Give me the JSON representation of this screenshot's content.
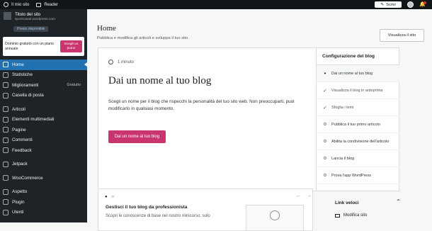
{
  "topbar": {
    "my_site": "Il mio sito",
    "reader": "Reader",
    "write": "Scrivi"
  },
  "site": {
    "title": "Titolo del sito",
    "url": "sportcasati.wordpress.com",
    "plan": "Presto disponibile"
  },
  "promo": {
    "text": "Dominio gratuito con un piano annuale",
    "button": "Scegli un piano"
  },
  "nav": [
    {
      "label": "Home",
      "extra": ""
    },
    {
      "label": "Statistiche",
      "extra": ""
    },
    {
      "label": "Miglioramenti",
      "extra": "Gratuito"
    },
    {
      "label": "Casella di posta",
      "extra": ""
    },
    {
      "label": "Articoli",
      "extra": ""
    },
    {
      "label": "Elementi multimediali",
      "extra": ""
    },
    {
      "label": "Pagine",
      "extra": ""
    },
    {
      "label": "Commenti",
      "extra": ""
    },
    {
      "label": "Feedback",
      "extra": ""
    },
    {
      "label": "Jetpack",
      "extra": ""
    },
    {
      "label": "WooCommerce",
      "extra": ""
    },
    {
      "label": "Aspetto",
      "extra": ""
    },
    {
      "label": "Plugin",
      "extra": ""
    },
    {
      "label": "Utenti",
      "extra": ""
    }
  ],
  "header": {
    "title": "Home",
    "subtitle": "Pubblica e modifica gli articoli e sviluppa il tuo sito.",
    "view_site": "Visualizza il sito"
  },
  "setup": {
    "time": "1 minuto",
    "heading": "Dai un nome al tuo blog",
    "paragraph": "Scegli un nome per il blog che rispecchi la personalità del tuo sito web. Non preoccuparti, puoi modificarlo in qualsiasi momento.",
    "button": "Dai un nome al tuo blog"
  },
  "checklist": {
    "title": "Configurazione del blog",
    "items": [
      {
        "label": "Dai un nome al tuo blog",
        "state": "current"
      },
      {
        "label": "Visualizza il blog in anteprima",
        "state": "done"
      },
      {
        "label": "Sfoglia i temi",
        "state": "done"
      },
      {
        "label": "Pubblica il tuo primo articolo",
        "state": "todo"
      },
      {
        "label": "Abilita la condivisione dell'articolo",
        "state": "todo"
      },
      {
        "label": "Lancia il blog",
        "state": "todo"
      },
      {
        "label": "Prova l'app WordPress",
        "state": "todo"
      }
    ]
  },
  "learn": {
    "heading": "Gestisci il tuo blog da professionista",
    "paragraph": "Scopri le conoscenze di base nel nostro minicorso: solo"
  },
  "quick": {
    "heading": "Link veloci",
    "item": "Modifica sito"
  }
}
